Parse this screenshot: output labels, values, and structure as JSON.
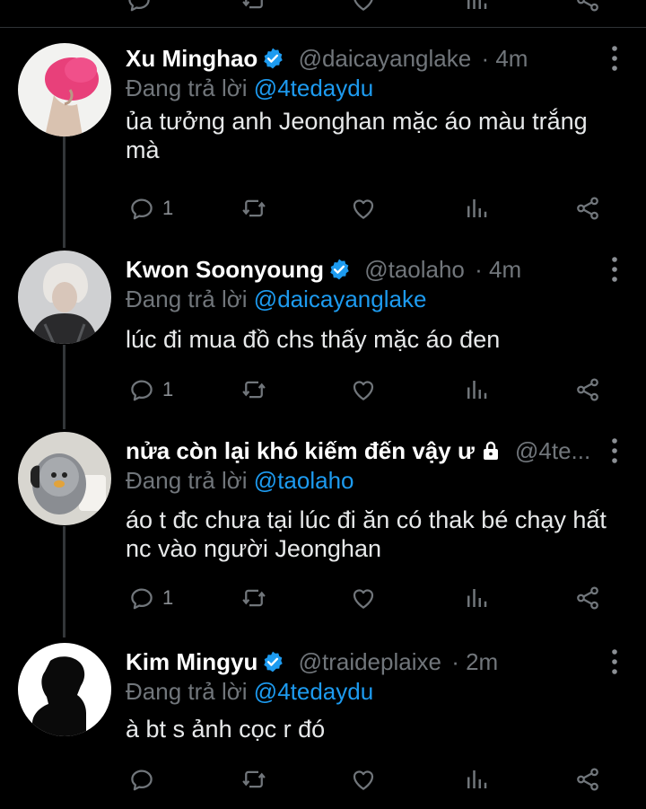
{
  "reply_prefix": "Đang trả lời",
  "tweets": [
    {
      "name": "Xu Minghao",
      "handle": "@daicayanglake",
      "time": "· 4m",
      "reply_to": "@4tedaydu",
      "text": "ủa tưởng anh Jeonghan mặc áo màu trắng mà",
      "reply_count": "1"
    },
    {
      "name": "Kwon Soonyoung",
      "handle": "@taolaho",
      "time": "· 4m",
      "reply_to": "@daicayanglake",
      "text": "lúc đi mua đồ chs thấy mặc áo đen",
      "reply_count": "1"
    },
    {
      "name": "nửa còn lại khó kiếm đến vậy ư",
      "handle": "@4te...",
      "time": "",
      "reply_to": "@taolaho",
      "text": "áo t đc chưa tại lúc đi ăn có thak bé chạy hất nc vào người Jeonghan",
      "reply_count": "1"
    },
    {
      "name": "Kim Mingyu",
      "handle": "@traideplaixe",
      "time": "· 2m",
      "reply_to": "@4tedaydu",
      "text": "à bt s ảnh cọc r đó",
      "reply_count": ""
    }
  ],
  "colors": {
    "background": "#000000",
    "text": "#e7e9ea",
    "muted": "#71767b",
    "accent": "#1d9bf0",
    "divider": "#2f3336"
  }
}
